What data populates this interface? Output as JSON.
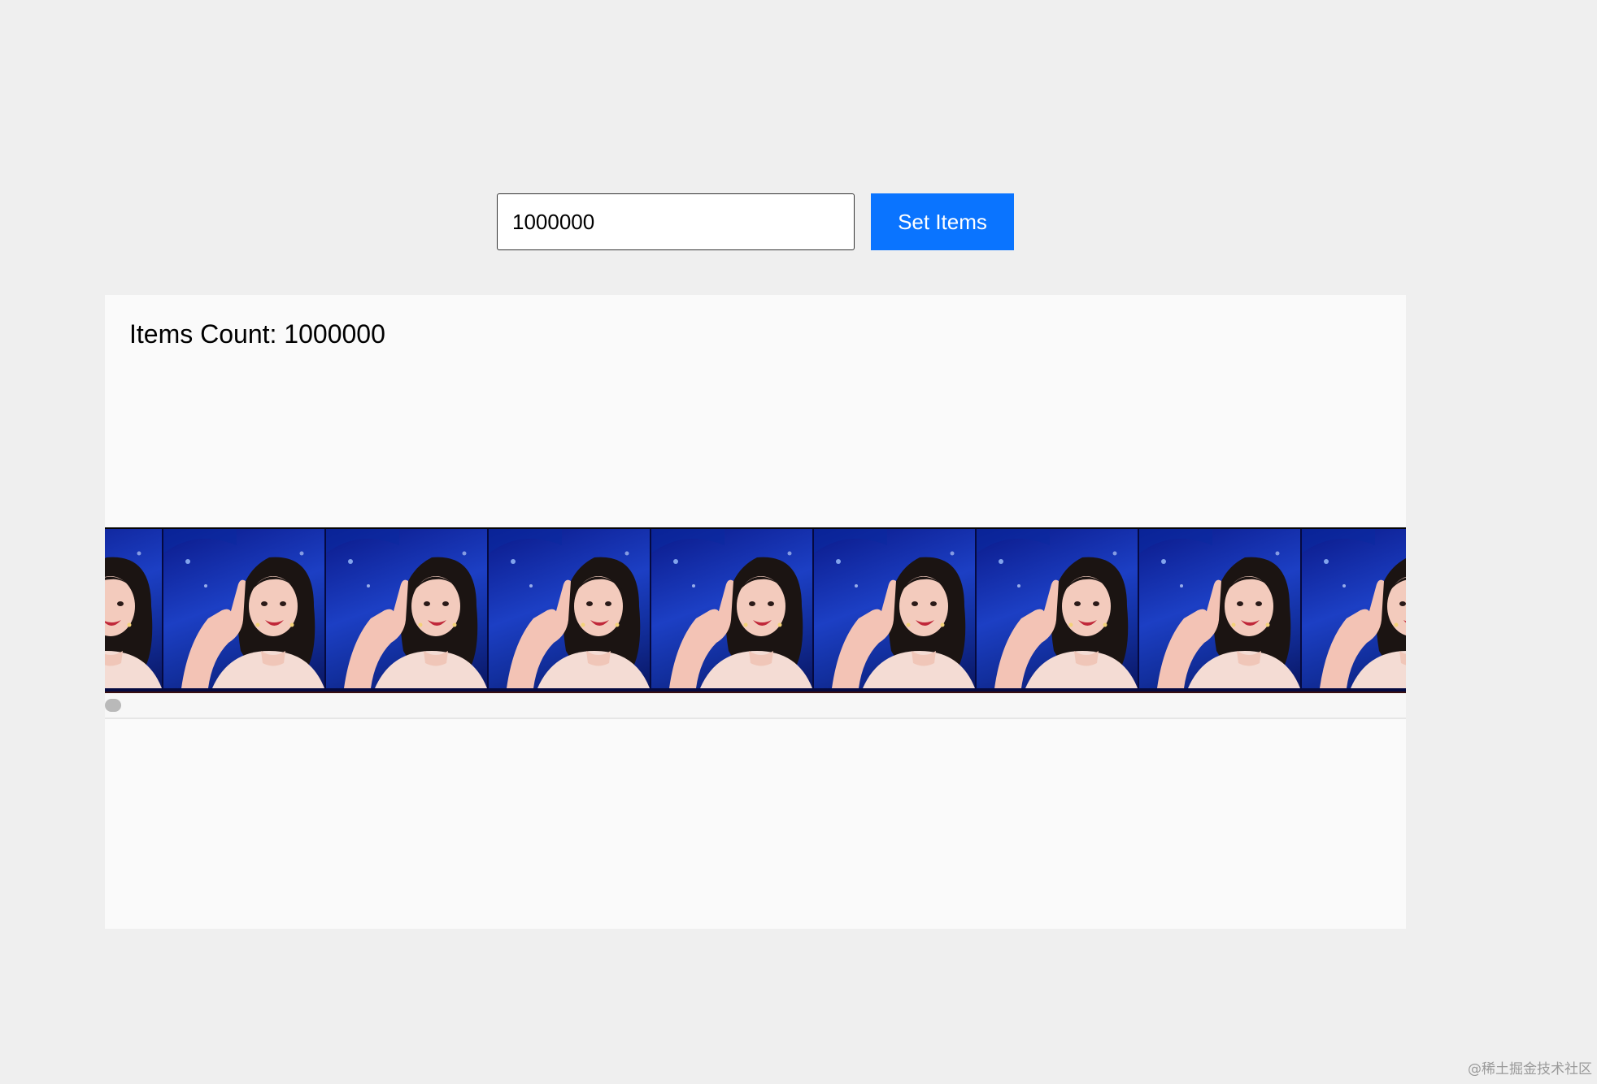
{
  "controls": {
    "count_input_value": "1000000",
    "set_button_label": "Set Items",
    "button_color": "#0a74ff"
  },
  "panel": {
    "items_count_label": "Items Count: 1000000"
  },
  "strip": {
    "thumbnail_count_visible": 10,
    "thumbnail_subject": "photo-portrait-woman-pointing-up"
  },
  "watermark": "@稀土掘金技术社区"
}
